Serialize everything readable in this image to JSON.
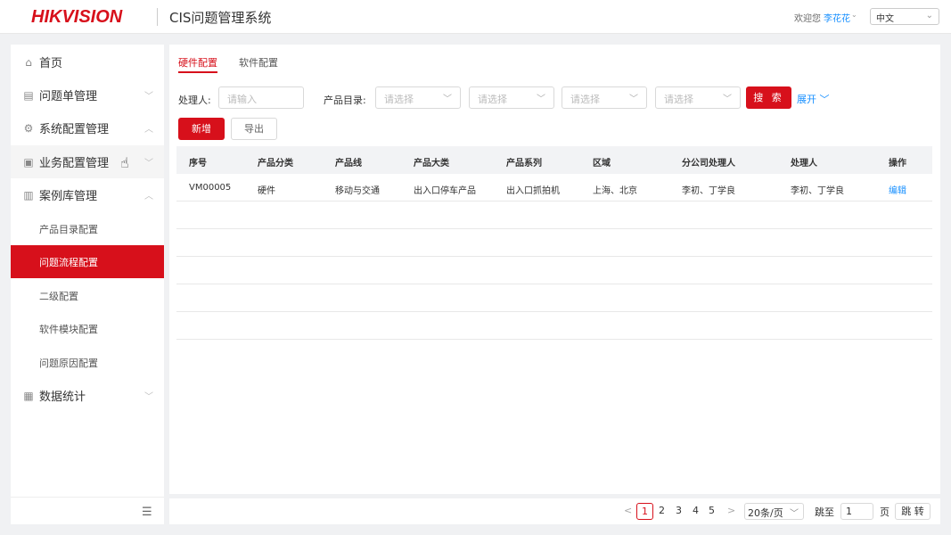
{
  "header": {
    "logo": "HIKVISION",
    "system_title": "CIS问题管理系统",
    "welcome": "欢迎您",
    "user": "李花花",
    "language": "中文"
  },
  "sidebar": {
    "items": [
      {
        "label": "首页",
        "icon": "home-icon"
      },
      {
        "label": "问题单管理",
        "icon": "document-icon"
      },
      {
        "label": "系统配置管理",
        "icon": "settings-icon"
      },
      {
        "label": "业务配置管理",
        "icon": "briefcase-icon"
      },
      {
        "label": "案例库管理",
        "icon": "library-icon"
      },
      {
        "label": "数据统计",
        "icon": "bar-chart-icon"
      }
    ],
    "sub_items": [
      {
        "label": "产品目录配置"
      },
      {
        "label": "问题流程配置"
      },
      {
        "label": "二级配置"
      },
      {
        "label": "软件模块配置"
      },
      {
        "label": "问题原因配置"
      }
    ]
  },
  "tabs": [
    {
      "label": "硬件配置"
    },
    {
      "label": "软件配置"
    }
  ],
  "filters": {
    "handler_label": "处理人:",
    "handler_placeholder": "请输入",
    "catalog_label": "产品目录:",
    "select_placeholder": "请选择",
    "search": "搜 索",
    "expand": "展开"
  },
  "actions": {
    "add": "新增",
    "export": "导出"
  },
  "table": {
    "columns": [
      "序号",
      "产品分类",
      "产品线",
      "产品大类",
      "产品系列",
      "区域",
      "分公司处理人",
      "处理人",
      "操作"
    ],
    "rows": [
      {
        "id": "VM00005",
        "category": "硬件",
        "line": "移动与交通",
        "major": "出入口停车产品",
        "series": "出入口抓拍机",
        "region": "上海、北京",
        "branch_handler": "李初、丁学良",
        "handler": "李初、丁学良",
        "action": "编辑"
      }
    ]
  },
  "pagination": {
    "prev": "<",
    "next": ">",
    "pages": [
      "1",
      "2",
      "3",
      "4",
      "5"
    ],
    "current": "1",
    "page_size": "20条/页",
    "jump_label": "跳至",
    "jump_value": "1",
    "page_unit": "页",
    "jump_button": "跳 转"
  },
  "colors": {
    "brand_red": "#d7101b",
    "link_blue": "#1890ff"
  }
}
